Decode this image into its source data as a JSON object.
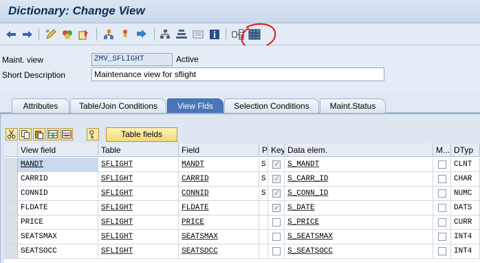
{
  "window": {
    "title": "Dictionary: Change View"
  },
  "header": {
    "maint_view_label": "Maint. view",
    "maint_view_value": "ZMV_SFLIGHT",
    "status": "Active",
    "short_desc_label": "Short Description",
    "short_desc_value": "Maintenance view for sflight"
  },
  "tabs": [
    {
      "label": "Attributes",
      "active": false
    },
    {
      "label": "Table/Join Conditions",
      "active": false
    },
    {
      "label": "View Flds",
      "active": true
    },
    {
      "label": "Selection Conditions",
      "active": false
    },
    {
      "label": "Maint.Status",
      "active": false
    }
  ],
  "panel": {
    "table_fields_button": "Table fields"
  },
  "grid": {
    "columns": [
      "View field",
      "Table",
      "Field",
      "P",
      "Key",
      "Data elem.",
      "M...",
      "DTyp"
    ],
    "rows": [
      {
        "view_field": "MANDT",
        "table": "SFLIGHT",
        "field": "MANDT",
        "p": "S",
        "key": true,
        "data_elem": "S_MANDT",
        "mod": false,
        "dtyp": "CLNT"
      },
      {
        "view_field": "CARRID",
        "table": "SFLIGHT",
        "field": "CARRID",
        "p": "S",
        "key": true,
        "data_elem": "S_CARR_ID",
        "mod": false,
        "dtyp": "CHAR"
      },
      {
        "view_field": "CONNID",
        "table": "SFLIGHT",
        "field": "CONNID",
        "p": "S",
        "key": true,
        "data_elem": "S_CONN_ID",
        "mod": false,
        "dtyp": "NUMC"
      },
      {
        "view_field": "FLDATE",
        "table": "SFLIGHT",
        "field": "FLDATE",
        "p": "",
        "key": true,
        "data_elem": "S_DATE",
        "mod": false,
        "dtyp": "DATS"
      },
      {
        "view_field": "PRICE",
        "table": "SFLIGHT",
        "field": "PRICE",
        "p": "",
        "key": false,
        "data_elem": "S_PRICE",
        "mod": false,
        "dtyp": "CURR"
      },
      {
        "view_field": "SEATSMAX",
        "table": "SFLIGHT",
        "field": "SEATSMAX",
        "p": "",
        "key": false,
        "data_elem": "S_SEATSMAX",
        "mod": false,
        "dtyp": "INT4"
      },
      {
        "view_field": "SEATSOCC",
        "table": "SFLIGHT",
        "field": "SEATSOCC",
        "p": "",
        "key": false,
        "data_elem": "S_SEATSOCC",
        "mod": false,
        "dtyp": "INT4"
      }
    ]
  },
  "colors": {
    "annotation_circle": "#e01818",
    "active_tab": "#4a75b8",
    "title": "#0b2d55"
  }
}
